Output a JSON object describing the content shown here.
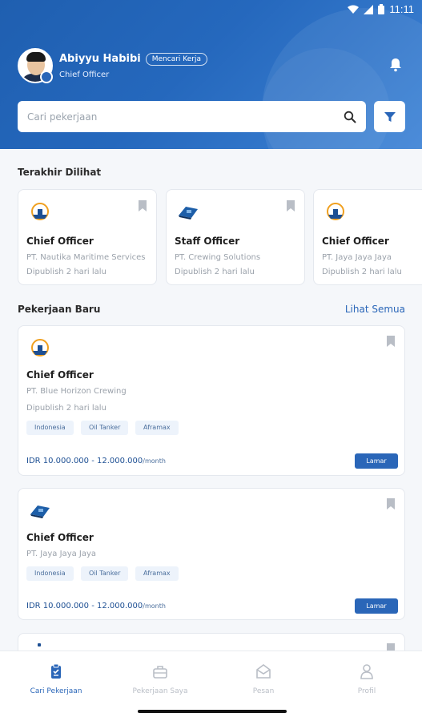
{
  "status_bar": {
    "time": "11:11"
  },
  "profile": {
    "name": "Abiyyu Habibi",
    "status": "Mencari Kerja",
    "role": "Chief Officer"
  },
  "search": {
    "placeholder": "Cari pekerjaan"
  },
  "recent": {
    "title": "Terakhir Dilihat",
    "cards": [
      {
        "title": "Chief Officer",
        "company": "PT. Nautika Maritime Services",
        "posted": "Dipublish 2 hari lalu"
      },
      {
        "title": "Staff Officer",
        "company": "PT. Crewing Solutions",
        "posted": "Dipublish 2 hari lalu"
      },
      {
        "title": "Chief Officer",
        "company": "PT. Jaya Jaya Jaya",
        "posted": "Dipublish 2 hari lalu"
      }
    ]
  },
  "new_jobs": {
    "title": "Pekerjaan Baru",
    "see_all": "Lihat Semua",
    "jobs": [
      {
        "title": "Chief Officer",
        "company": "PT. Blue Horizon Crewing",
        "posted": "Dipublish 2 hari lalu",
        "tags": [
          "Indonesia",
          "Oil Tanker",
          "Aframax"
        ],
        "salary": "IDR 10.000.000 - 12.000.000",
        "period": "/month",
        "apply": "Lamar"
      },
      {
        "title": "Chief Officer",
        "company": "PT. Jaya Jaya Jaya",
        "tags": [
          "Indonesia",
          "Oil Tanker",
          "Aframax"
        ],
        "salary": "IDR 10.000.000 - 12.000.000",
        "period": "/month",
        "apply": "Lamar"
      }
    ]
  },
  "nav": {
    "items": [
      {
        "label": "Cari Pekerjaan"
      },
      {
        "label": "Pekerjaan Saya"
      },
      {
        "label": "Pesan"
      },
      {
        "label": "Profil"
      }
    ]
  },
  "colors": {
    "primary": "#2a66b8",
    "header": "#2568bd",
    "muted": "#b9bec6",
    "tag_bg": "#edf3fb"
  }
}
